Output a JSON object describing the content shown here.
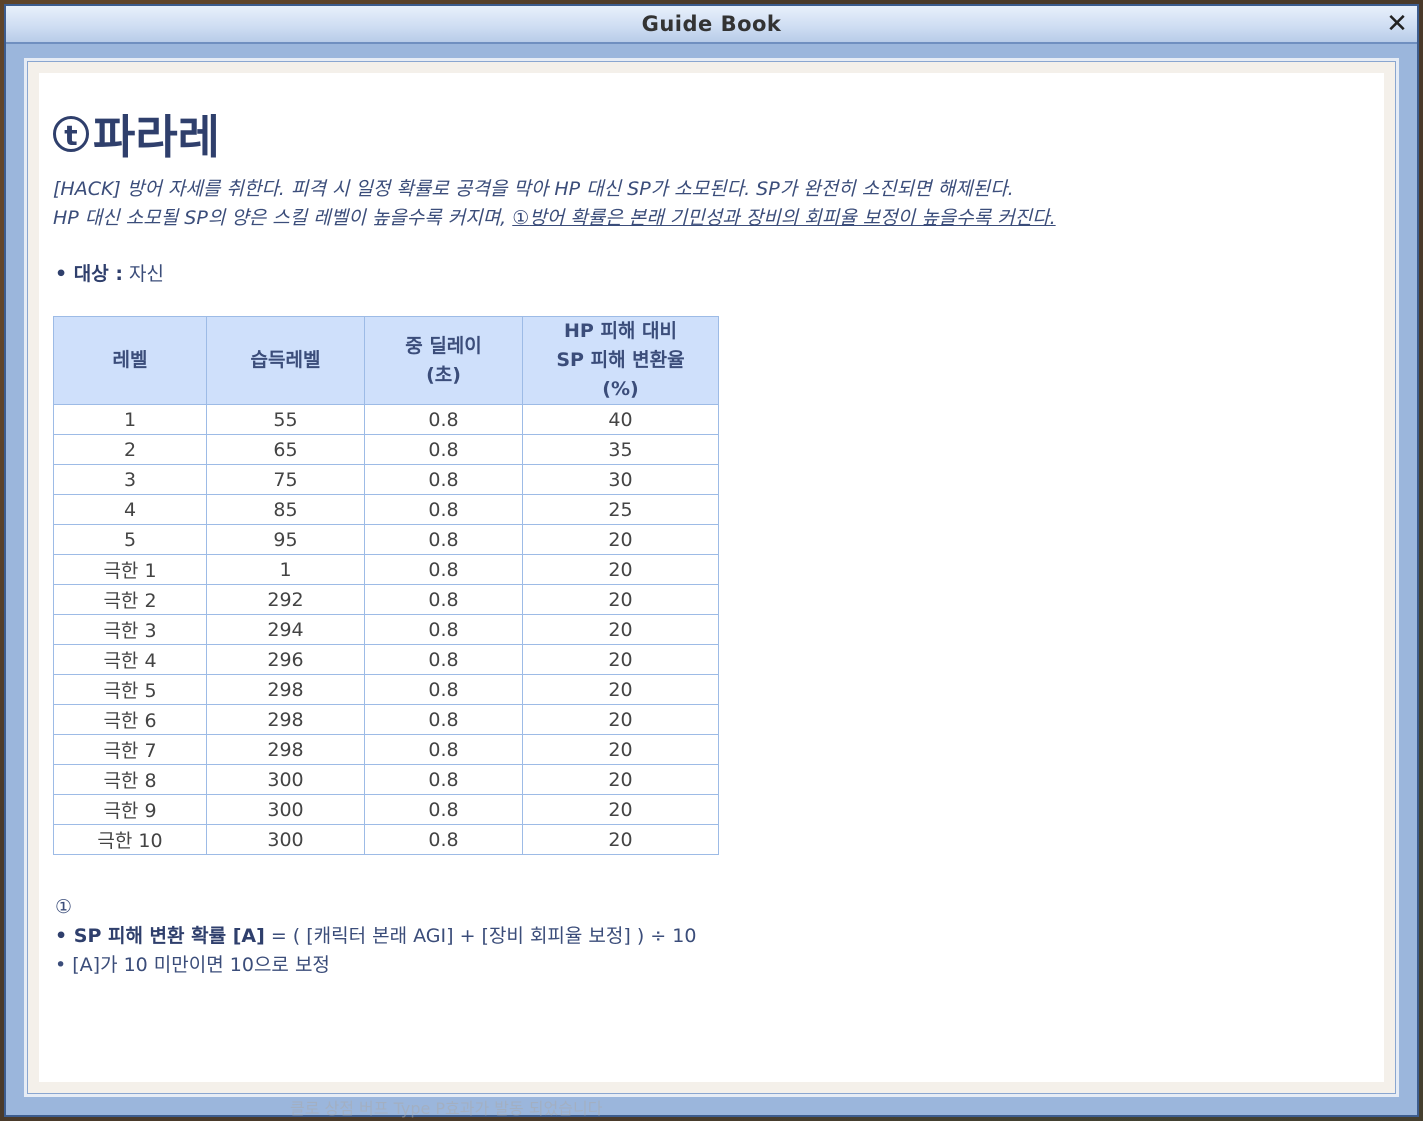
{
  "window": {
    "title": "Guide Book",
    "close_label": "✕"
  },
  "skill": {
    "icon_letter": "t",
    "name": "파라레",
    "desc_line1": "[HACK] 방어 자세를 취한다. 피격 시 일정 확률로 공격을 막아 HP 대신 SP가 소모된다. SP가 완전히 소진되면 해제된다.",
    "desc_line2_plain": "HP 대신 소모될 SP의 양은 스킬 레벨이 높을수록 커지며, ",
    "desc_line2_marker": "①",
    "desc_line2_underlined": "방어 확률은 본래 기민성과 장비의 회피율 보정이 높을수록 커진다.",
    "target_label": "• 대상 :",
    "target_value": " 자신"
  },
  "table": {
    "headers": [
      "레벨",
      "습득레벨",
      "중 딜레이\n(초)",
      "HP 피해 대비\nSP 피해 변환율\n(%)"
    ],
    "rows": [
      [
        "1",
        "55",
        "0.8",
        "40"
      ],
      [
        "2",
        "65",
        "0.8",
        "35"
      ],
      [
        "3",
        "75",
        "0.8",
        "30"
      ],
      [
        "4",
        "85",
        "0.8",
        "25"
      ],
      [
        "5",
        "95",
        "0.8",
        "20"
      ],
      [
        "극한 1",
        "1",
        "0.8",
        "20"
      ],
      [
        "극한 2",
        "292",
        "0.8",
        "20"
      ],
      [
        "극한 3",
        "294",
        "0.8",
        "20"
      ],
      [
        "극한 4",
        "296",
        "0.8",
        "20"
      ],
      [
        "극한 5",
        "298",
        "0.8",
        "20"
      ],
      [
        "극한 6",
        "298",
        "0.8",
        "20"
      ],
      [
        "극한 7",
        "298",
        "0.8",
        "20"
      ],
      [
        "극한 8",
        "300",
        "0.8",
        "20"
      ],
      [
        "극한 9",
        "300",
        "0.8",
        "20"
      ],
      [
        "극한 10",
        "300",
        "0.8",
        "20"
      ]
    ]
  },
  "notes": {
    "marker": "①",
    "formula_label": "• SP 피해 변환 확률 [A]",
    "formula_value": " = ( [캐릭터 본래 AGI] + [장비 회피율 보정] ) ÷ 10",
    "rule": "• [A]가 10 미만이면 10으로 보정"
  },
  "background_chat": "클로 상점 버프 Type P효과가 발동 되었습니다"
}
